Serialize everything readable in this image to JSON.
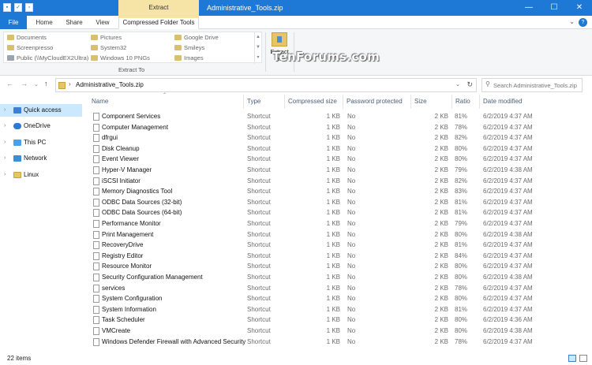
{
  "window": {
    "title": "Administrative_Tools.zip",
    "context_header": "Extract",
    "buttons": [
      "—",
      "☐",
      "✕"
    ]
  },
  "ribbon_tabs": [
    "File",
    "Home",
    "Share",
    "View",
    "Compressed Folder Tools"
  ],
  "extract_to": {
    "label": "Extract To",
    "items": [
      [
        "Documents",
        "Pictures",
        "Google Drive"
      ],
      [
        "Screenpresso",
        "System32",
        "Smileys"
      ],
      [
        "Public (\\\\MyCloudEX2Ultra)",
        "Windows 10 PNGs",
        "Images"
      ]
    ]
  },
  "extract_all": {
    "line1": "Extract",
    "line2": "all"
  },
  "watermark": "TenForums.com",
  "address": {
    "path": "Administrative_Tools.zip",
    "search_placeholder": "Search Administrative_Tools.zip"
  },
  "nav": [
    {
      "label": "Quick access",
      "icon": "star",
      "selected": true
    },
    {
      "label": "OneDrive",
      "icon": "cloud"
    },
    {
      "label": "This PC",
      "icon": "pc"
    },
    {
      "label": "Network",
      "icon": "network"
    },
    {
      "label": "Linux",
      "icon": "folder"
    }
  ],
  "columns": [
    "Name",
    "Type",
    "Compressed size",
    "Password protected",
    "Size",
    "Ratio",
    "Date modified"
  ],
  "files": [
    [
      "Component Services",
      "Shortcut",
      "1 KB",
      "No",
      "2 KB",
      "81%",
      "6/2/2019 4:37 AM"
    ],
    [
      "Computer Management",
      "Shortcut",
      "1 KB",
      "No",
      "2 KB",
      "78%",
      "6/2/2019 4:37 AM"
    ],
    [
      "dfrgui",
      "Shortcut",
      "1 KB",
      "No",
      "2 KB",
      "82%",
      "6/2/2019 4:37 AM"
    ],
    [
      "Disk Cleanup",
      "Shortcut",
      "1 KB",
      "No",
      "2 KB",
      "80%",
      "6/2/2019 4:37 AM"
    ],
    [
      "Event Viewer",
      "Shortcut",
      "1 KB",
      "No",
      "2 KB",
      "80%",
      "6/2/2019 4:37 AM"
    ],
    [
      "Hyper-V Manager",
      "Shortcut",
      "1 KB",
      "No",
      "2 KB",
      "79%",
      "6/2/2019 4:38 AM"
    ],
    [
      "iSCSI Initiator",
      "Shortcut",
      "1 KB",
      "No",
      "2 KB",
      "82%",
      "6/2/2019 4:37 AM"
    ],
    [
      "Memory Diagnostics Tool",
      "Shortcut",
      "1 KB",
      "No",
      "2 KB",
      "83%",
      "6/2/2019 4:37 AM"
    ],
    [
      "ODBC Data Sources (32-bit)",
      "Shortcut",
      "1 KB",
      "No",
      "2 KB",
      "81%",
      "6/2/2019 4:37 AM"
    ],
    [
      "ODBC Data Sources (64-bit)",
      "Shortcut",
      "1 KB",
      "No",
      "2 KB",
      "81%",
      "6/2/2019 4:37 AM"
    ],
    [
      "Performance Monitor",
      "Shortcut",
      "1 KB",
      "No",
      "2 KB",
      "79%",
      "6/2/2019 4:37 AM"
    ],
    [
      "Print Management",
      "Shortcut",
      "1 KB",
      "No",
      "2 KB",
      "80%",
      "6/2/2019 4:38 AM"
    ],
    [
      "RecoveryDrive",
      "Shortcut",
      "1 KB",
      "No",
      "2 KB",
      "81%",
      "6/2/2019 4:37 AM"
    ],
    [
      "Registry Editor",
      "Shortcut",
      "1 KB",
      "No",
      "2 KB",
      "84%",
      "6/2/2019 4:37 AM"
    ],
    [
      "Resource Monitor",
      "Shortcut",
      "1 KB",
      "No",
      "2 KB",
      "80%",
      "6/2/2019 4:37 AM"
    ],
    [
      "Security Configuration Management",
      "Shortcut",
      "1 KB",
      "No",
      "2 KB",
      "80%",
      "6/2/2019 4:38 AM"
    ],
    [
      "services",
      "Shortcut",
      "1 KB",
      "No",
      "2 KB",
      "78%",
      "6/2/2019 4:37 AM"
    ],
    [
      "System Configuration",
      "Shortcut",
      "1 KB",
      "No",
      "2 KB",
      "80%",
      "6/2/2019 4:37 AM"
    ],
    [
      "System Information",
      "Shortcut",
      "1 KB",
      "No",
      "2 KB",
      "81%",
      "6/2/2019 4:37 AM"
    ],
    [
      "Task Scheduler",
      "Shortcut",
      "1 KB",
      "No",
      "2 KB",
      "80%",
      "6/2/2019 4:36 AM"
    ],
    [
      "VMCreate",
      "Shortcut",
      "1 KB",
      "No",
      "2 KB",
      "80%",
      "6/2/2019 4:38 AM"
    ],
    [
      "Windows Defender Firewall with Advanced Security",
      "Shortcut",
      "1 KB",
      "No",
      "2 KB",
      "78%",
      "6/2/2019 4:37 AM"
    ]
  ],
  "status": {
    "count": "22 items"
  },
  "colors": {
    "accent": "#1e78d6",
    "context": "#f6e4a6",
    "selection": "#cce8ff"
  }
}
